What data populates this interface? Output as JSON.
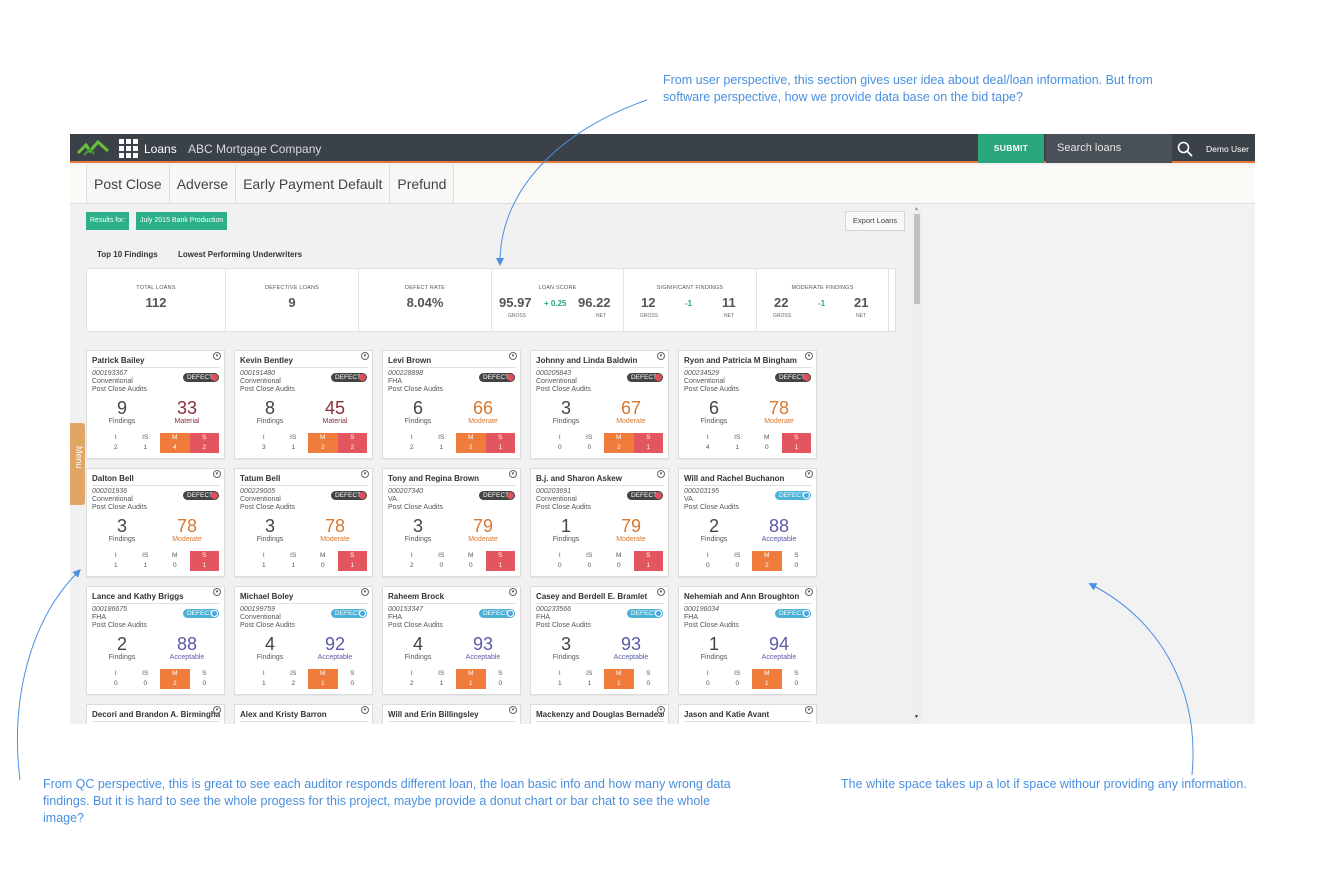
{
  "annotations": {
    "top": "From user perspective, this section gives user idea about deal/loan information. But from software perspective, how we provide data base on the bid tape?",
    "left": "From QC perspective, this is great to see each auditor responds different loan, the loan basic info and how many wrong data findings. But it is hard to see the whole progess for this project, maybe provide a donut chart or bar chat to see the whole image?",
    "right": "The white space takes up a lot if space withour providing any information."
  },
  "topbar": {
    "app_name": "Loans",
    "company": "ABC Mortgage Company",
    "submit_label": "SUBMIT",
    "search_placeholder": "Search loans",
    "user": "Demo User",
    "icons": [
      "logo-icon",
      "grid-icon",
      "search-icon"
    ]
  },
  "tabs": [
    "Post Close",
    "Adverse",
    "Early Payment Default",
    "Prefund"
  ],
  "filters": {
    "results_for": "Results for:",
    "period": "July 2015 Bank Production",
    "export": "Export Loans"
  },
  "subtabs": [
    "Top 10 Findings",
    "Lowest Performing Underwriters"
  ],
  "stats": {
    "total_loans": {
      "label": "TOTAL LOANS",
      "value": "112"
    },
    "defective_loans": {
      "label": "DEFECTIVE LOANS",
      "value": "9"
    },
    "defect_rate": {
      "label": "DEFECT RATE",
      "value": "8.04%"
    },
    "loan_score": {
      "label": "LOAN SCORE",
      "gross": "95.97",
      "delta": "+ 0.25",
      "net": "96.22",
      "gross_label": "GROSS",
      "net_label": "NET"
    },
    "significant": {
      "label": "SIGNIFICANT FINDINGS",
      "gross": "12",
      "delta": "-1",
      "net": "11",
      "gross_label": "GROSS",
      "net_label": "NET"
    },
    "moderate": {
      "label": "MODERATE FINDINGS",
      "gross": "22",
      "delta": "-1",
      "net": "21",
      "gross_label": "GROSS",
      "net_label": "NET"
    }
  },
  "menu_label": "Menu",
  "cards": [
    {
      "name": "Patrick Bailey",
      "id": "000193367",
      "type": "Conventional",
      "audit": "Post Close Audits",
      "badge": "DEFECT",
      "badge_style": "dark",
      "findings": "9",
      "findings_label": "Findings",
      "score": "33",
      "rating": "Material",
      "vals": [
        "2",
        "1",
        "4",
        "2"
      ],
      "hi": [
        "",
        "",
        "or",
        "rd"
      ]
    },
    {
      "name": "Kevin Bentley",
      "id": "000191480",
      "type": "Conventional",
      "audit": "Post Close Audits",
      "badge": "DEFECT",
      "badge_style": "dark",
      "findings": "8",
      "findings_label": "Findings",
      "score": "45",
      "rating": "Material",
      "vals": [
        "3",
        "1",
        "2",
        "2"
      ],
      "hi": [
        "",
        "",
        "or",
        "rd"
      ]
    },
    {
      "name": "Levi Brown",
      "id": "000228898",
      "type": "FHA",
      "audit": "Post Close Audits",
      "badge": "DEFECT",
      "badge_style": "dark",
      "findings": "6",
      "findings_label": "Findings",
      "score": "66",
      "rating": "Moderate",
      "vals": [
        "2",
        "1",
        "2",
        "1"
      ],
      "hi": [
        "",
        "",
        "or",
        "rd"
      ]
    },
    {
      "name": "Johnny and Linda Baldwin",
      "id": "000205843",
      "type": "Conventional",
      "audit": "Post Close Audits",
      "badge": "DEFECT",
      "badge_style": "dark",
      "findings": "3",
      "findings_label": "Findings",
      "score": "67",
      "rating": "Moderate",
      "vals": [
        "0",
        "0",
        "2",
        "1"
      ],
      "hi": [
        "",
        "",
        "or",
        "rd"
      ]
    },
    {
      "name": "Ryon and Patricia M Bingham",
      "id": "000234529",
      "type": "Conventional",
      "audit": "Post Close Audits",
      "badge": "DEFECT",
      "badge_style": "dark",
      "findings": "6",
      "findings_label": "Findings",
      "score": "78",
      "rating": "Moderate",
      "vals": [
        "4",
        "1",
        "0",
        "1"
      ],
      "hi": [
        "",
        "",
        "",
        "rd"
      ]
    },
    {
      "name": "Dalton Bell",
      "id": "000201936",
      "type": "Conventional",
      "audit": "Post Close Audits",
      "badge": "DEFECT",
      "badge_style": "dark",
      "findings": "3",
      "findings_label": "Findings",
      "score": "78",
      "rating": "Moderate",
      "vals": [
        "1",
        "1",
        "0",
        "1"
      ],
      "hi": [
        "",
        "",
        "",
        "rd"
      ]
    },
    {
      "name": "Tatum Bell",
      "id": "000229005",
      "type": "Conventional",
      "audit": "Post Close Audits",
      "badge": "DEFECT",
      "badge_style": "dark",
      "findings": "3",
      "findings_label": "Findings",
      "score": "78",
      "rating": "Moderate",
      "vals": [
        "1",
        "1",
        "0",
        "1"
      ],
      "hi": [
        "",
        "",
        "",
        "rd"
      ]
    },
    {
      "name": "Tony and Regina Brown",
      "id": "000207340",
      "type": "VA",
      "audit": "Post Close Audits",
      "badge": "DEFECT",
      "badge_style": "dark",
      "findings": "3",
      "findings_label": "Findings",
      "score": "79",
      "rating": "Moderate",
      "vals": [
        "2",
        "0",
        "0",
        "1"
      ],
      "hi": [
        "",
        "",
        "",
        "rd"
      ]
    },
    {
      "name": "B.j. and Sharon Askew",
      "id": "000203691",
      "type": "Conventional",
      "audit": "Post Close Audits",
      "badge": "DEFECT",
      "badge_style": "dark",
      "findings": "1",
      "findings_label": "Findings",
      "score": "79",
      "rating": "Moderate",
      "vals": [
        "0",
        "0",
        "0",
        "1"
      ],
      "hi": [
        "",
        "",
        "",
        "rd"
      ]
    },
    {
      "name": "Will and Rachel Buchanon",
      "id": "000203195",
      "type": "VA",
      "audit": "Post Close Audits",
      "badge": "DEFECT",
      "badge_style": "blue",
      "findings": "2",
      "findings_label": "Findings",
      "score": "88",
      "rating": "Acceptable",
      "vals": [
        "0",
        "0",
        "2",
        "0"
      ],
      "hi": [
        "",
        "",
        "or",
        ""
      ]
    },
    {
      "name": "Lance and Kathy Briggs",
      "id": "000186675",
      "type": "FHA",
      "audit": "Post Close Audits",
      "badge": "DEFECT",
      "badge_style": "blue",
      "findings": "2",
      "findings_label": "Findings",
      "score": "88",
      "rating": "Acceptable",
      "vals": [
        "0",
        "0",
        "2",
        "0"
      ],
      "hi": [
        "",
        "",
        "or",
        ""
      ]
    },
    {
      "name": "Michael Boley",
      "id": "000199759",
      "type": "Conventional",
      "audit": "Post Close Audits",
      "badge": "DEFECT",
      "badge_style": "blue",
      "findings": "4",
      "findings_label": "Findings",
      "score": "92",
      "rating": "Acceptable",
      "vals": [
        "1",
        "2",
        "1",
        "0"
      ],
      "hi": [
        "",
        "",
        "or",
        ""
      ]
    },
    {
      "name": "Raheem Brock",
      "id": "000153347",
      "type": "FHA",
      "audit": "Post Close Audits",
      "badge": "DEFECT",
      "badge_style": "blue",
      "findings": "4",
      "findings_label": "Findings",
      "score": "93",
      "rating": "Acceptable",
      "vals": [
        "2",
        "1",
        "1",
        "0"
      ],
      "hi": [
        "",
        "",
        "or",
        ""
      ]
    },
    {
      "name": "Casey and Berdell E. Bramlet",
      "id": "000233566",
      "type": "FHA",
      "audit": "Post Close Audits",
      "badge": "DEFECT",
      "badge_style": "blue",
      "findings": "3",
      "findings_label": "Findings",
      "score": "93",
      "rating": "Acceptable",
      "vals": [
        "1",
        "1",
        "1",
        "0"
      ],
      "hi": [
        "",
        "",
        "or",
        ""
      ]
    },
    {
      "name": "Nehemiah and Ann Broughton",
      "id": "000196034",
      "type": "FHA",
      "audit": "Post Close Audits",
      "badge": "DEFECT",
      "badge_style": "blue",
      "findings": "1",
      "findings_label": "Findings",
      "score": "94",
      "rating": "Acceptable",
      "vals": [
        "0",
        "0",
        "1",
        "0"
      ],
      "hi": [
        "",
        "",
        "or",
        ""
      ]
    },
    {
      "name": "Decori and Brandon A. Birmingham"
    },
    {
      "name": "Alex and Kristy Barron"
    },
    {
      "name": "Will and Erin Billingsley"
    },
    {
      "name": "Mackenzy and Douglas Bernadeau"
    },
    {
      "name": "Jason and Katie Avant"
    }
  ],
  "cell_headers": [
    "I",
    "IS",
    "M",
    "S"
  ],
  "colors": {
    "accent": "#2bb08a",
    "topbar": "#3b4148",
    "orange": "#ef7c3b",
    "red": "#e35660",
    "annotation": "#4a8fe0"
  }
}
